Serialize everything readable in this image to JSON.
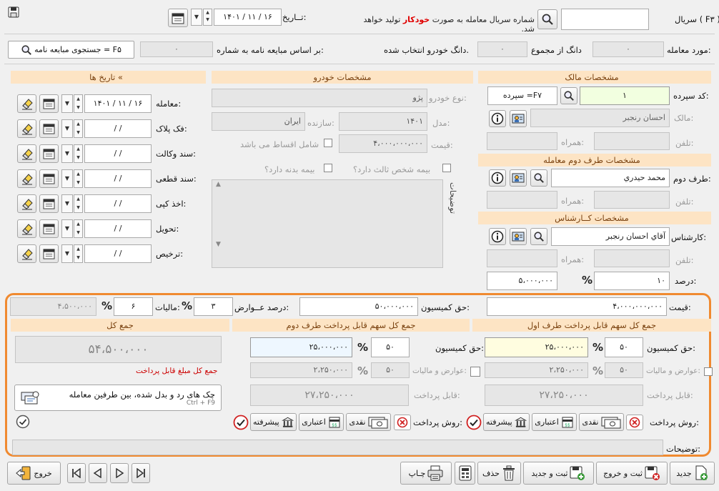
{
  "top": {
    "serial_label": "سریال ( F۳ ):",
    "serial_note_a": "شماره سریال معامله به صورت",
    "serial_note_b": "خودکار",
    "serial_note_c": "تولید خواهد شد.",
    "date_label": "تــاریخ:",
    "date_value": "۱۴۰۱ / ۱۱ / ۱۶",
    "deal_label": "مورد معامله:",
    "deal_value": "۰",
    "dang_label": "دانگ از مجموع",
    "dang_value": "۰",
    "dang_note": "دانگ خودرو انتخاب شده.",
    "contract_label": "بر اساس مبایعه نامه به شماره:",
    "contract_value": "۰",
    "contract_search": "جستجوی مبایعه نامه = F۵"
  },
  "owner": {
    "header": "مشخصات مالک",
    "code_label": "کد سپرده:",
    "code_value": "۱",
    "deposit_tag": "F۷= سپرده",
    "owner_label": "مالک:",
    "owner_value": "احسان رنجبر",
    "phone_label": "تلفن:",
    "mobile_label": "همراه:"
  },
  "party2": {
    "header": "مشخصات طرف دوم معامله",
    "label": "طرف دوم:",
    "value": "محمد حيدري",
    "phone_label": "تلفن:",
    "mobile_label": "همراه:"
  },
  "expert": {
    "header": "مشخصات کــارشناس",
    "label": "کارشناس:",
    "value": "آقاي احسان رنجبر",
    "phone_label": "تلفن:",
    "mobile_label": "همراه:",
    "percent_label": "درصد:",
    "percent_value": "۱۰",
    "amount_value": "۵،۰۰۰،۰۰۰"
  },
  "car": {
    "header": "مشخصات خودرو",
    "type_label": "نوع خودرو:",
    "type_value": "پژو",
    "model_label": "مدل:",
    "model_value": "۱۴۰۱",
    "maker_label": "سازنده:",
    "maker_value": "ایران",
    "price_label": "قیمت:",
    "price_value": "۴،۰۰۰،۰۰۰،۰۰۰",
    "installment_label": "شامل اقساط می باشد",
    "third_party_label": "بیمه شخص ثالث دارد؟",
    "body_ins_label": "بیمه بدنه دارد؟",
    "notes_label": "توضیحات"
  },
  "dates": {
    "header": "» تاریخ ها",
    "rows": [
      {
        "label": "معامله:",
        "value": "۱۴۰۱ / ۱۱ / ۱۶"
      },
      {
        "label": "فک پلاک:",
        "value": "/     /"
      },
      {
        "label": "سند وکالت:",
        "value": "/     /"
      },
      {
        "label": "سند قطعی:",
        "value": "/     /"
      },
      {
        "label": "اخذ کپی:",
        "value": "/     /"
      },
      {
        "label": "تحویل:",
        "value": "/     /"
      },
      {
        "label": "ترخیص:",
        "value": "/     /"
      }
    ]
  },
  "bottom": {
    "price_label": "قیمت:",
    "price_value": "۴،۰۰۰،۰۰۰،۰۰۰",
    "commission_label": "حق کمیسیون:",
    "commission_value": "۵۰،۰۰۰،۰۰۰",
    "duties_pct_label": "درصد عــوارض:",
    "duties_pct_value": "۳",
    "tax_label": "مالیات:",
    "tax_value": "۶",
    "tax_amount": "۴،۵۰۰،۰۰۰",
    "p1_header": "جمع کل سهم قابل پرداخت طرف اول",
    "p2_header": "جمع کل سهم قابل پرداخت طرف دوم",
    "total_header": "جمع کل",
    "comm_label": "حق کمیسیون:",
    "duties_label": "عوارض و مالیات:",
    "payable_label": "قابل پرداخت:",
    "p1_pct": "۵۰",
    "p1_comm": "۲۵،۰۰۰،۰۰۰",
    "p1_pct2": "۵۰",
    "p1_duties": "۲،۲۵۰،۰۰۰",
    "p1_payable": "۲۷،۲۵۰،۰۰۰",
    "p2_pct": "۵۰",
    "p2_comm": "۲۵،۰۰۰،۰۰۰",
    "p2_pct2": "۵۰",
    "p2_duties": "۲،۲۵۰،۰۰۰",
    "p2_payable": "۲۷،۲۵۰،۰۰۰",
    "grand_total": "۵۴،۵۰۰،۰۰۰",
    "grand_total_note": "جمع کل مبلغ قابل پرداخت",
    "cheques_label": "چک های رد و بدل شده، بین طرفین معامله",
    "cheques_shortcut": "Ctrl + F9",
    "pay_method_label": "روش پرداخت:",
    "pay_cash": "نقدی",
    "pay_credit": "اعتباری",
    "pay_advanced": "پیشرفته",
    "notes_label": "توضیحات:"
  },
  "toolbar": {
    "new": "جدید",
    "save_exit": "ثبت و خروج",
    "save_new": "ثبت و جدید",
    "delete": "حذف",
    "print": "چـاپ",
    "exit": "خروج"
  },
  "colors": {
    "section_header_bg": "#fde4c4",
    "highlight_border": "#f08a30",
    "auto_word": "#e00000",
    "total_note": "#cc0000"
  }
}
